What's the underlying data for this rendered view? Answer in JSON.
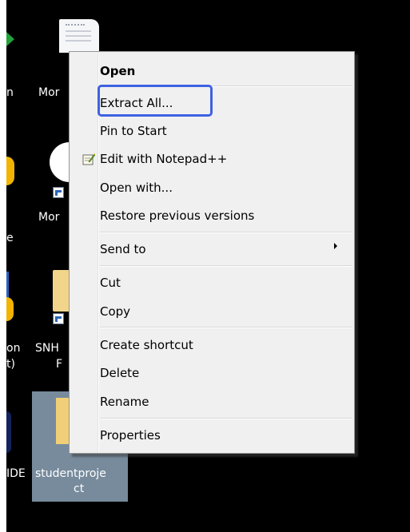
{
  "desktop": {
    "labels": {
      "mon_a": "n",
      "mor_1": "Mor",
      "mor_2": "Mor",
      "e_frag": "e",
      "on_frag": "on",
      "t_frag": "t)",
      "snh": "SNH",
      "f_frag": "F",
      "ide": "IDE",
      "folder_line1": "studentproje",
      "folder_line2": "ct"
    }
  },
  "context_menu": {
    "items": [
      {
        "label": "Open",
        "bold": true
      },
      {
        "label": "Extract All...",
        "highlighted": true
      },
      {
        "label": "Pin to Start"
      },
      {
        "label": "Edit with Notepad++",
        "icon": "notepad-plus-plus-icon"
      },
      {
        "label": "Open with..."
      },
      {
        "label": "Restore previous versions"
      },
      {
        "label": "Send to",
        "has_submenu": true
      },
      {
        "label": "Cut"
      },
      {
        "label": "Copy"
      },
      {
        "label": "Create shortcut"
      },
      {
        "label": "Delete"
      },
      {
        "label": "Rename"
      },
      {
        "label": "Properties"
      }
    ],
    "highlight_color": "#3d62e2"
  }
}
